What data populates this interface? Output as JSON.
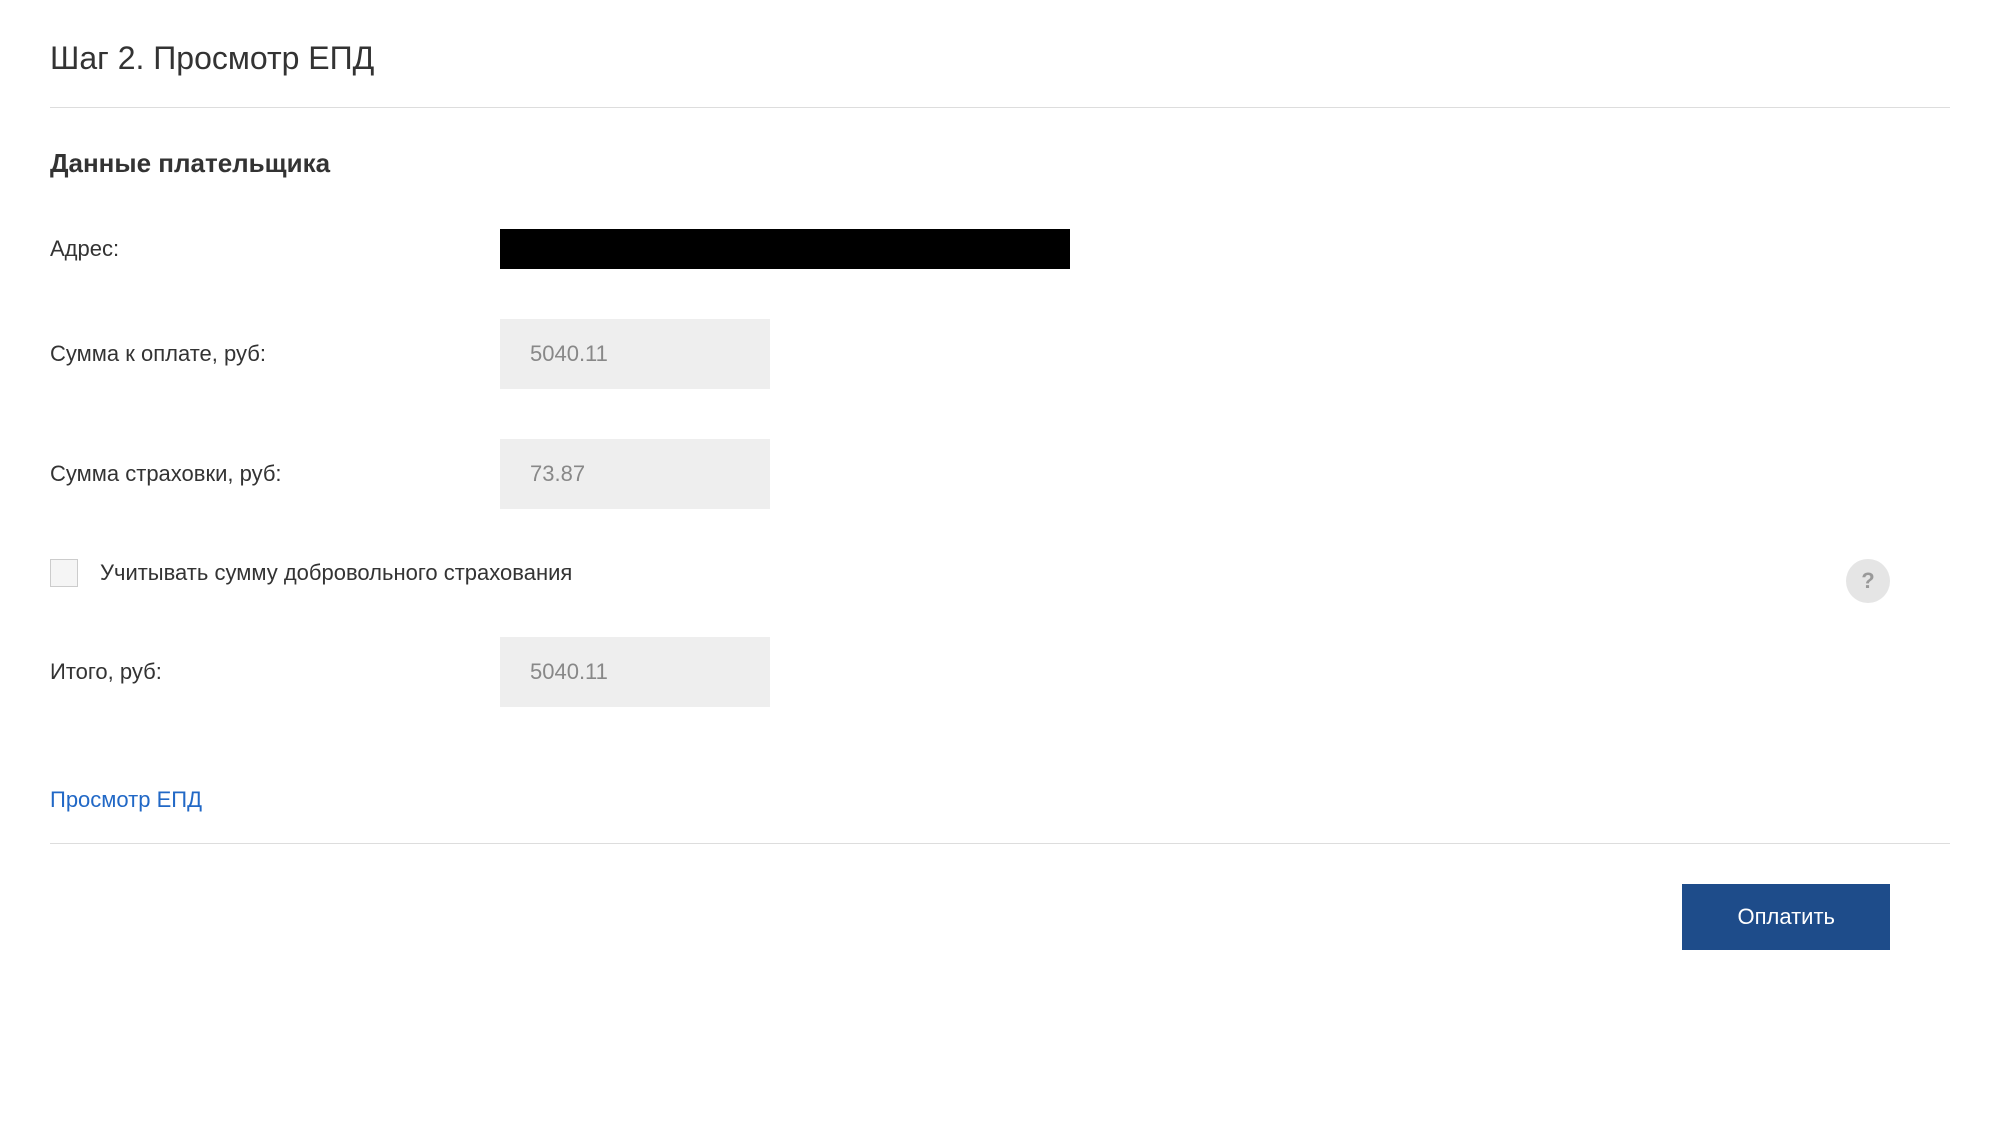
{
  "step_title": "Шаг 2. Просмотр ЕПД",
  "section_title": "Данные плательщика",
  "fields": {
    "address_label": "Адрес:",
    "amount_label": "Сумма к оплате, руб:",
    "amount_value": "5040.11",
    "insurance_label": "Сумма страховки, руб:",
    "insurance_value": "73.87",
    "total_label": "Итого, руб:",
    "total_value": "5040.11"
  },
  "checkbox": {
    "label": "Учитывать сумму добровольного страхования"
  },
  "help_icon": "?",
  "view_link": "Просмотр ЕПД",
  "pay_button": "Оплатить"
}
